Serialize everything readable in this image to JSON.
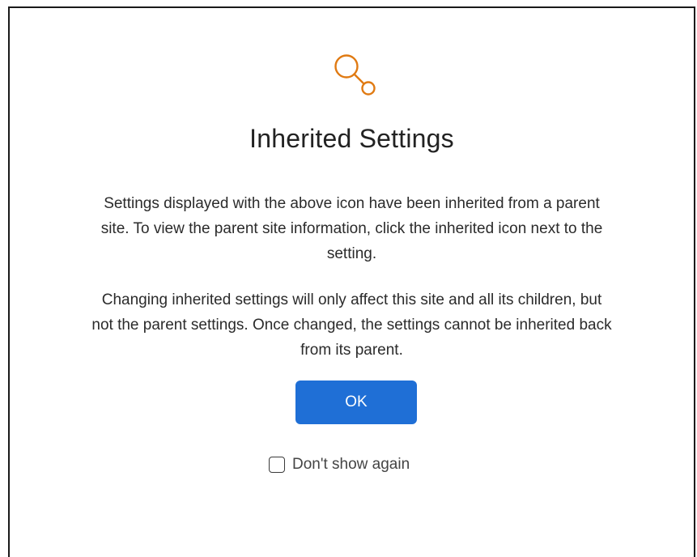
{
  "dialog": {
    "icon": "inherited-settings-icon",
    "title": "Inherited Settings",
    "paragraph_1": "Settings displayed with the above icon have been inherited from a parent site. To view the parent site information, click the inherited icon next to the setting.",
    "paragraph_2": "Changing inherited settings will only affect this site and all its children, but not the parent settings. Once changed, the settings cannot be inherited back from its parent.",
    "ok_label": "OK",
    "dont_show_label": "Don't show again",
    "dont_show_checked": false
  },
  "colors": {
    "icon": "#e07a12",
    "button": "#1f6fd6",
    "border": "#1a1a1a"
  }
}
